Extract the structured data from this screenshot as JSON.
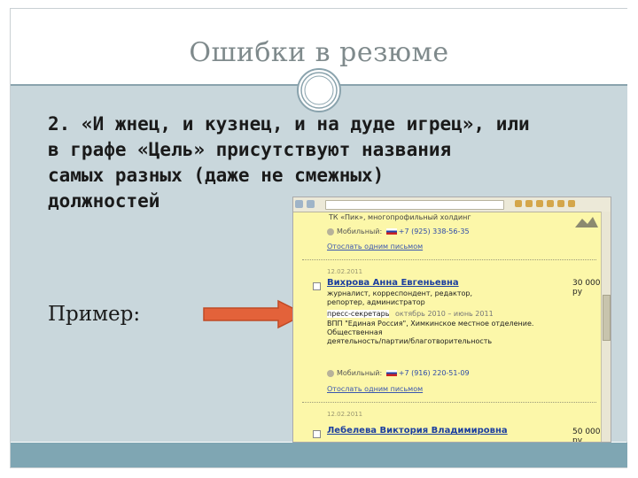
{
  "slide": {
    "title": "Ошибки в резюме",
    "main_lines": [
      "2. «И жнец, и кузнец, и на дуде игрец», или",
      "в графе «Цель» присутствуют названия",
      "самых разных (даже не смежных)",
      "должностей"
    ],
    "example_label": "Пример:"
  },
  "screenshot": {
    "top_partial": "ТК «Пик», многопрофильный холдинг",
    "phone_label": "Мобильный:",
    "phone_1": "+7 (925) 338-56-35",
    "phone_2": "+7 (916) 220-51-09",
    "send_link": "Отослать одним письмом",
    "date_1": "12.02.2011",
    "name_1": "Вихрова Анна Евгеньевна",
    "salary_1": "30 000 ру",
    "desc_1": "журналист, корреспондент, редактор, репортер, администратор",
    "press_label": "пресс-секретарь",
    "press_dates": "октябрь 2010 – июнь 2011",
    "org_line_1": "ВПП \"Единая Россия\", Химкинское местное отделение.",
    "org_line_2": "Общественная",
    "org_line_3": "деятельность/партии/благотворительность",
    "date_2": "12.02.2011",
    "name_2": "Лебелева Виктория Владимировна",
    "salary_2": "50 000 ру"
  },
  "colors": {
    "content_bg": "#c9d7dc",
    "footer_band": "#7fa6b3",
    "arrow": "#e3623a",
    "title_text": "#7f8a8c"
  },
  "icons": [
    "circle-ornament-icon",
    "right-arrow-icon"
  ]
}
